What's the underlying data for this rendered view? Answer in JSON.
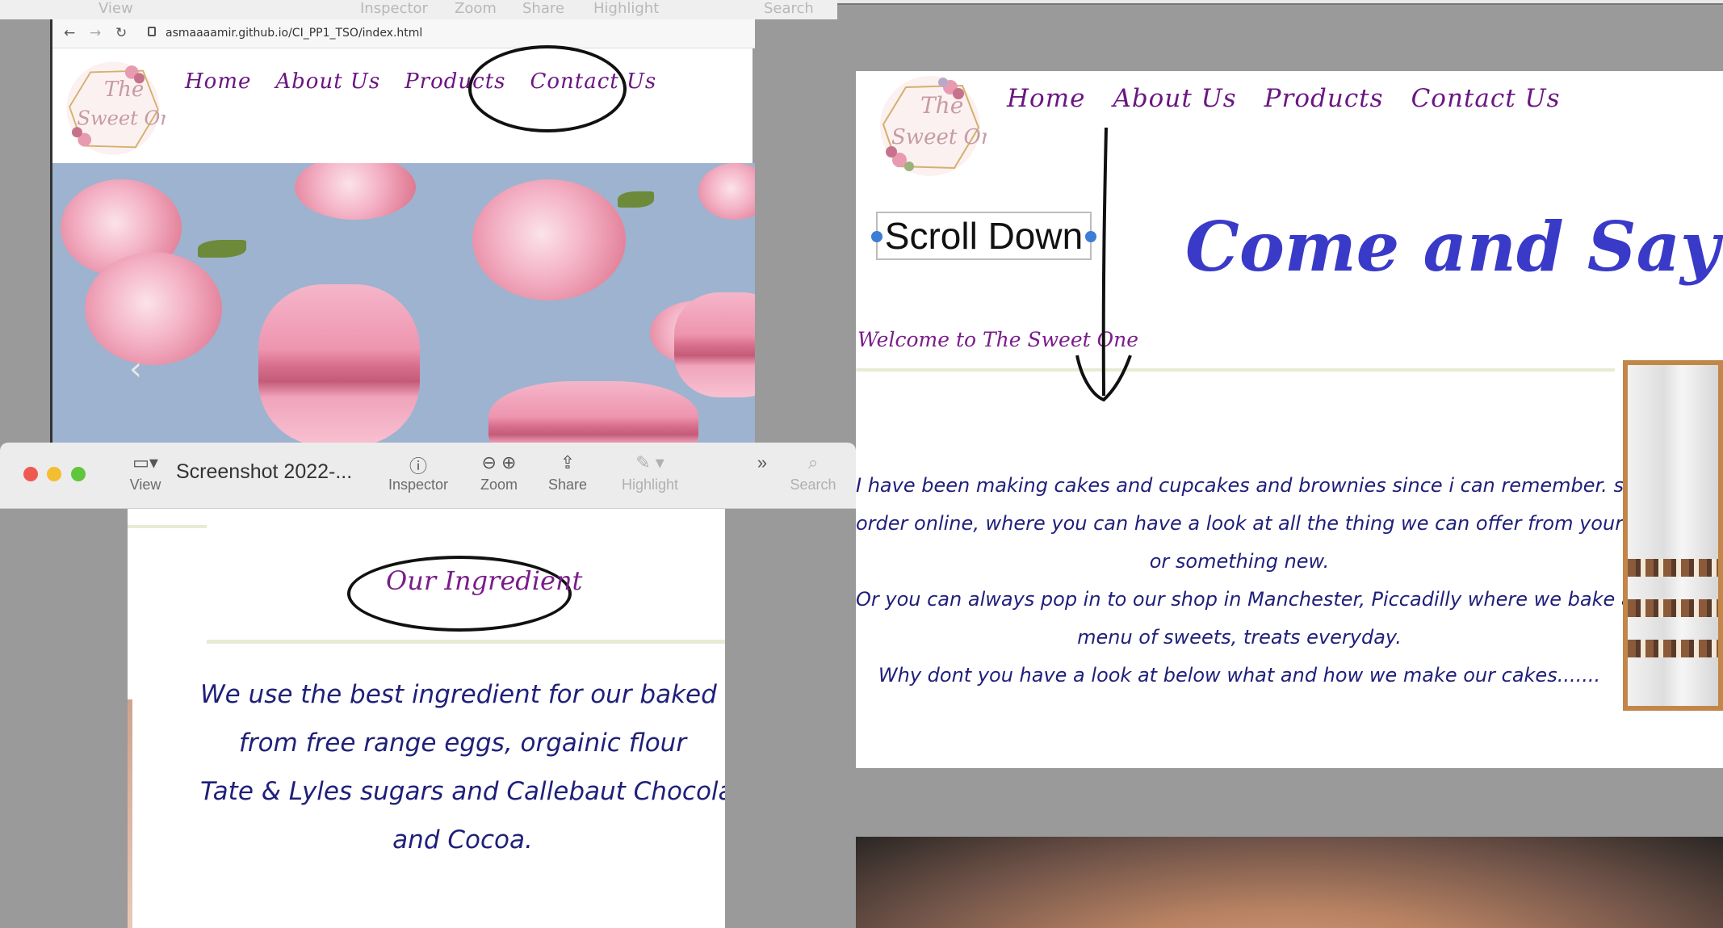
{
  "site": {
    "logo_text": [
      "The",
      "Sweet One"
    ],
    "nav": [
      "Home",
      "About Us",
      "Products",
      "Contact Us"
    ]
  },
  "top_window": {
    "menubar": [
      "View",
      "Inspector",
      "Zoom",
      "Share",
      "Highlight",
      "Search"
    ],
    "url": "asmaaaamir.github.io/CI_PP1_TSO/index.html",
    "hero_prev_arrow": "‹"
  },
  "right_window": {
    "annotation": "Scroll Down",
    "heading": "Come and Say Hi !",
    "welcome": "Welcome to The Sweet One",
    "story_lines": [
      "I have been making cakes and cupcakes and brownies since i can remember. so you can",
      "order online, where you can have a look at all the thing we can offer from your favourits",
      "or something new.",
      "Or you can always pop in to our shop in Manchester, Piccadilly where we bake a new",
      "menu of sweets, treats everyday.",
      "Why dont you have a look at below what and how we make our cakes......."
    ]
  },
  "preview_window": {
    "title": "Screenshot 2022-...",
    "toolbar": {
      "view": "View",
      "inspector": "Inspector",
      "zoom": "Zoom",
      "share": "Share",
      "highlight": "Highlight",
      "search": "Search"
    },
    "section_title": "Our Ingredient",
    "ingredient_lines": [
      "We use the best ingredient for our baked goods,",
      "from free range eggs, orgainic flour",
      "Tate & Lyles sugars and Callebaut Chocolate",
      "and Cocoa."
    ]
  },
  "colors": {
    "nav_purple": "#6b1683",
    "heading_blue": "#3a3ac9",
    "body_navy": "#1f1f7a",
    "frame_brown": "#c28748",
    "annotation_blue": "#3c7dd6"
  }
}
